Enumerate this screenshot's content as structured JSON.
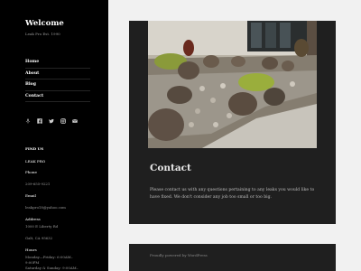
{
  "site": {
    "title": "Welcome",
    "description": "Leak Pro Est. 1990"
  },
  "nav": {
    "items": [
      {
        "label": "Home"
      },
      {
        "label": "About"
      },
      {
        "label": "Blog"
      },
      {
        "label": "Contact"
      }
    ]
  },
  "social_icons": [
    "yelp-icon",
    "facebook-icon",
    "twitter-icon",
    "instagram-icon",
    "email-icon"
  ],
  "widget": {
    "heading": "FIND US",
    "company": "LEAK PRO",
    "phone_title": "Phone",
    "phone": "209-655-9221",
    "email_title": "Email",
    "email": "leakpro18@yahoo.com",
    "address_title": "Address",
    "address_line1": "1000 E Liberty Rd",
    "address_line2": "Galt, CA 95632",
    "hours_title": "Hours",
    "hours_line1": "Monday—Friday: 6:00AM–",
    "hours_line2": "9:00PM",
    "hours_line3": "Saturday & Sunday: 9:00AM–"
  },
  "post": {
    "title": "Contact",
    "body": "Please contact us with any questions pertaining to any leaks you would like to have fixed. We don't consider any job too small or too big."
  },
  "footer": {
    "text": "Proudly powered by WordPress"
  },
  "colors": {
    "sidebar_bg": "#000000",
    "page_bg": "#f1f1f1",
    "card_bg": "#1f1f1f"
  }
}
